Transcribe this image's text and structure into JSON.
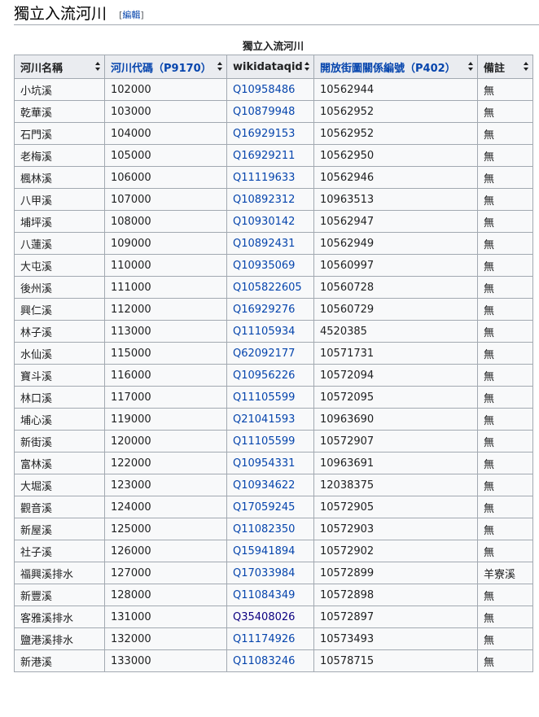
{
  "section": {
    "title": "獨立入流河川",
    "edit_open": "[",
    "edit_label": "編輯",
    "edit_close": "]"
  },
  "table": {
    "caption": "獨立入流河川",
    "columns": [
      {
        "label": "河川名稱",
        "link": false,
        "prop": ""
      },
      {
        "label": "河川代碼",
        "link": true,
        "prop": "（P9170）"
      },
      {
        "label": "wikidataqid",
        "link": false,
        "prop": ""
      },
      {
        "label": "開放街圖關係編號",
        "link": true,
        "prop": "（P402）"
      },
      {
        "label": "備註",
        "link": false,
        "prop": ""
      }
    ],
    "rows": [
      {
        "name": "小坑溪",
        "code": "102000",
        "qid": "Q10958486",
        "osm": "10562944",
        "note": "無"
      },
      {
        "name": "乾華溪",
        "code": "103000",
        "qid": "Q10879948",
        "osm": "10562952",
        "note": "無"
      },
      {
        "name": "石門溪",
        "code": "104000",
        "qid": "Q16929153",
        "osm": "10562952",
        "note": "無"
      },
      {
        "name": "老梅溪",
        "code": "105000",
        "qid": "Q16929211",
        "osm": "10562950",
        "note": "無"
      },
      {
        "name": "楓林溪",
        "code": "106000",
        "qid": "Q11119633",
        "osm": "10562946",
        "note": "無"
      },
      {
        "name": "八甲溪",
        "code": "107000",
        "qid": "Q10892312",
        "osm": "10963513",
        "note": "無"
      },
      {
        "name": "埔坪溪",
        "code": "108000",
        "qid": "Q10930142",
        "osm": "10562947",
        "note": "無"
      },
      {
        "name": "八蓮溪",
        "code": "109000",
        "qid": "Q10892431",
        "osm": "10562949",
        "note": "無"
      },
      {
        "name": "大屯溪",
        "code": "110000",
        "qid": "Q10935069",
        "osm": "10560997",
        "note": "無"
      },
      {
        "name": "後州溪",
        "code": "111000",
        "qid": "Q105822605",
        "osm": "10560728",
        "note": "無"
      },
      {
        "name": "興仁溪",
        "code": "112000",
        "qid": "Q16929276",
        "osm": "10560729",
        "note": "無"
      },
      {
        "name": "林子溪",
        "code": "113000",
        "qid": "Q11105934",
        "osm": "4520385",
        "note": "無"
      },
      {
        "name": "水仙溪",
        "code": "115000",
        "qid": "Q62092177",
        "osm": "10571731",
        "note": "無"
      },
      {
        "name": "寶斗溪",
        "code": "116000",
        "qid": "Q10956226",
        "osm": "10572094",
        "note": "無"
      },
      {
        "name": "林口溪",
        "code": "117000",
        "qid": "Q11105599",
        "osm": "10572095",
        "note": "無"
      },
      {
        "name": "埔心溪",
        "code": "119000",
        "qid": "Q21041593",
        "osm": "10963690",
        "note": "無"
      },
      {
        "name": "新街溪",
        "code": "120000",
        "qid": "Q11105599",
        "osm": "10572907",
        "note": "無"
      },
      {
        "name": "富林溪",
        "code": "122000",
        "qid": "Q10954331",
        "osm": "10963691",
        "note": "無"
      },
      {
        "name": "大堀溪",
        "code": "123000",
        "qid": "Q10934622",
        "osm": "12038375",
        "note": "無"
      },
      {
        "name": "觀音溪",
        "code": "124000",
        "qid": "Q17059245",
        "osm": "10572905",
        "note": "無"
      },
      {
        "name": "新屋溪",
        "code": "125000",
        "qid": "Q11082350",
        "osm": "10572903",
        "note": "無"
      },
      {
        "name": "社子溪",
        "code": "126000",
        "qid": "Q15941894",
        "osm": "10572902",
        "note": "無"
      },
      {
        "name": "福興溪排水",
        "code": "127000",
        "qid": "Q17033984",
        "osm": "10572899",
        "note": "羊寮溪"
      },
      {
        "name": "新豐溪",
        "code": "128000",
        "qid": "Q11084349",
        "osm": "10572898",
        "note": "無"
      },
      {
        "name": "客雅溪排水",
        "code": "131000",
        "qid": "Q35408026",
        "osm": "10572897",
        "note": "無",
        "visited": true
      },
      {
        "name": "鹽港溪排水",
        "code": "132000",
        "qid": "Q11174926",
        "osm": "10573493",
        "note": "無"
      },
      {
        "name": "新港溪",
        "code": "133000",
        "qid": "Q11083246",
        "osm": "10578715",
        "note": "無"
      }
    ]
  },
  "colors": {
    "link": "#0645ad",
    "visited_link": "#0b0080",
    "header_bg": "#eaecf0",
    "cell_bg": "#f8f9fa",
    "border": "#a2a9b1"
  }
}
